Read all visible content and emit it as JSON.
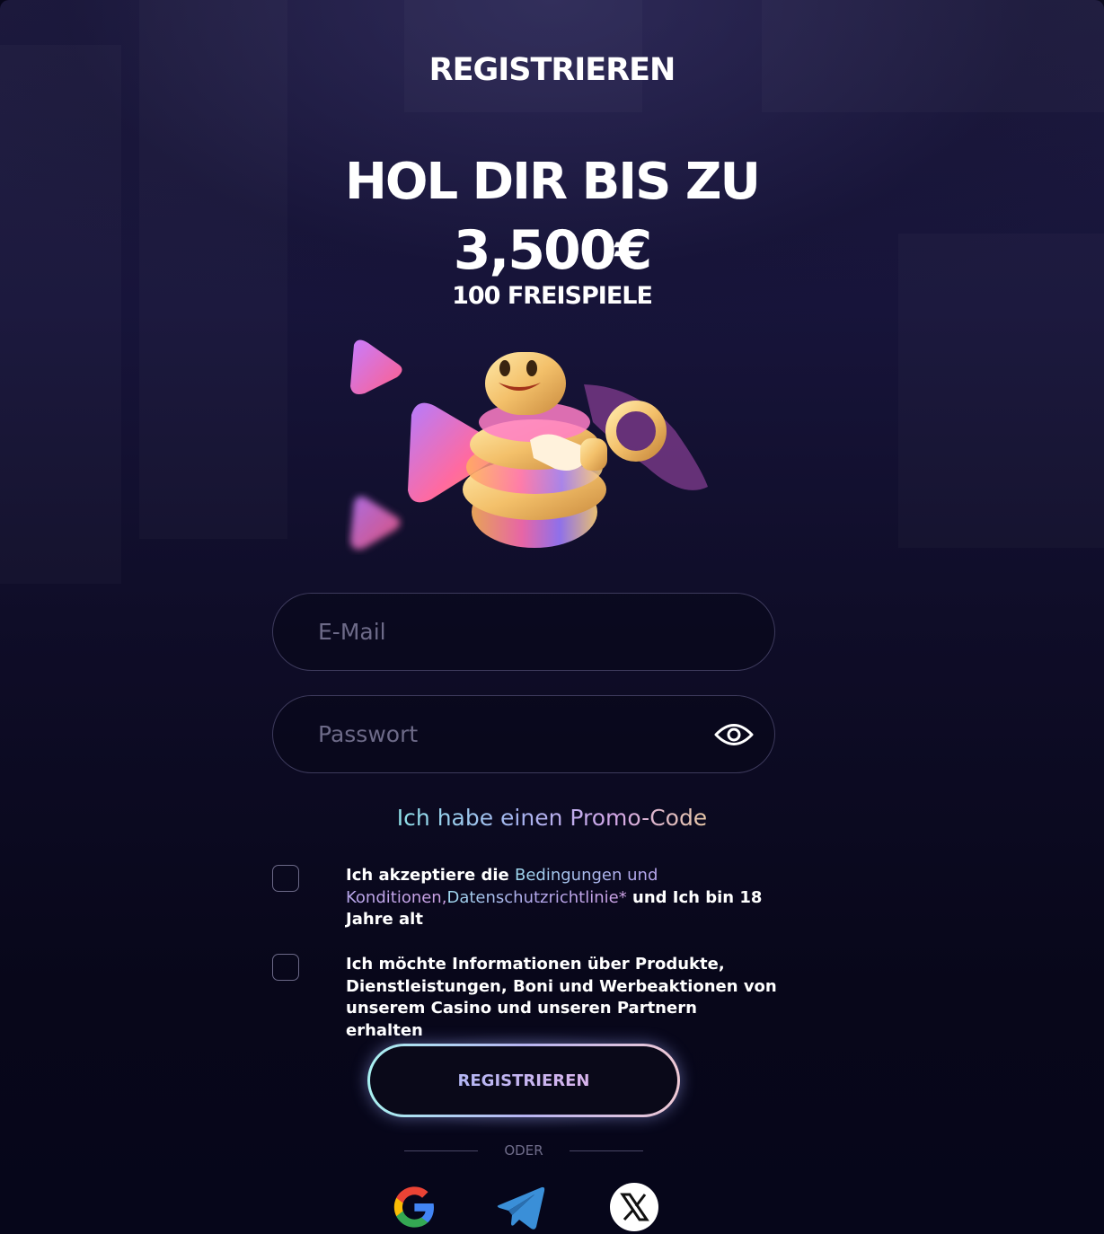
{
  "page": {
    "title": "REGISTRIEREN"
  },
  "hero": {
    "line1": "HOL DIR BIS ZU",
    "line2": "3,500€",
    "line3": "100 FREISPIELE"
  },
  "form": {
    "email_placeholder": "E-Mail",
    "password_placeholder": "Passwort",
    "promo_link": "Ich habe einen Promo-Code",
    "terms": {
      "prefix": "Ich akzeptiere die ",
      "link1": "Bedingungen und Konditionen,",
      "link2": "Datenschutzrichtlinie*",
      "suffix": " und Ich bin 18 Jahre alt"
    },
    "marketing": "Ich möchte Informationen über Produkte, Dienstleistungen, Boni und Werbeaktionen von unserem Casino und unseren Partnern erhalten",
    "submit_label": "REGISTRIEREN",
    "or_label": "ODER"
  },
  "social": {
    "icons": [
      "google-icon",
      "telegram-icon",
      "x-icon"
    ]
  },
  "colors": {
    "accent_start": "#a9f1f1",
    "accent_mid": "#b7b4f2",
    "accent_end": "#efc9d5",
    "background": "#07061a"
  }
}
